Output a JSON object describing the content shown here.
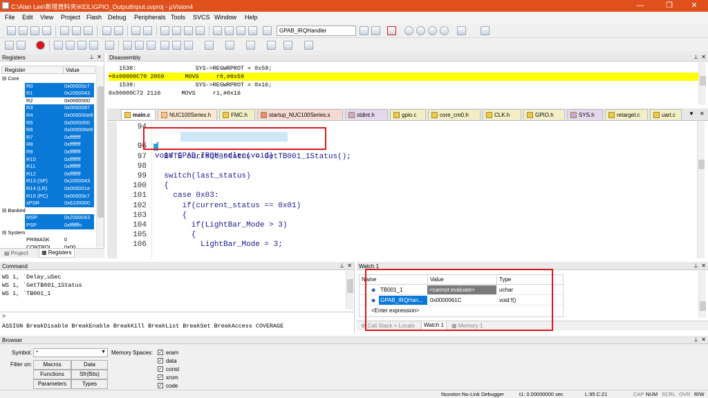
{
  "window": {
    "title": "C:\\Alan Lee\\新增資料夾\\KEIL\\GPIO_OutputInput.uvproj - µVision4",
    "min": "—",
    "max": "❐",
    "close": "✕"
  },
  "menu": [
    "File",
    "Edit",
    "View",
    "Project",
    "Flash",
    "Debug",
    "Peripherals",
    "Tools",
    "SVCS",
    "Window",
    "Help"
  ],
  "toolbar": {
    "function_combo": "GPAB_IRQHandler"
  },
  "registers": {
    "title": "Registers",
    "col_register": "Register",
    "col_value": "Value",
    "group_core": "Core",
    "core": [
      {
        "name": "R0",
        "value": "0x00000c7"
      },
      {
        "name": "R1",
        "value": "0x2000043"
      },
      {
        "name": "R2",
        "value": "0x0000000"
      },
      {
        "name": "R3",
        "value": "0x0000097"
      },
      {
        "name": "R4",
        "value": "0x000000e8"
      },
      {
        "name": "R5",
        "value": "0x0000000"
      },
      {
        "name": "R6",
        "value": "0x000000e8"
      },
      {
        "name": "R7",
        "value": "0xffffffff"
      },
      {
        "name": "R8",
        "value": "0xffffffff"
      },
      {
        "name": "R9",
        "value": "0xffffffff"
      },
      {
        "name": "R10",
        "value": "0xffffffff"
      },
      {
        "name": "R11",
        "value": "0xffffffff"
      },
      {
        "name": "R12",
        "value": "0xffffffff"
      },
      {
        "name": "R13 (SP)",
        "value": "0x2000043"
      },
      {
        "name": "R14 (LR)",
        "value": "0x000001e"
      },
      {
        "name": "R15 (PC)",
        "value": "0x00000c7"
      },
      {
        "name": "xPSR",
        "value": "0x6100000"
      }
    ],
    "group_banked": "Banked",
    "banked": [
      {
        "name": "MSP",
        "value": "0x2000043"
      },
      {
        "name": "PSP",
        "value": "0xfffffffc"
      }
    ],
    "group_system": "System",
    "system": [
      {
        "name": "PRIMASK",
        "value": "0"
      },
      {
        "name": "CONTROL",
        "value": "0x00"
      }
    ],
    "tab_project": "Project",
    "tab_registers": "Registers"
  },
  "disassembly": {
    "title": "Disassembly",
    "lines": [
      "   1538:                 SYS->REGWRPROT = 0x59;",
      "0x00000C70 2059      MOVS     r0,#0x59",
      "   1539:                 SYS->REGWRPROT = 0x16;",
      "0x00000C72 2116      MOVS     r1,#0x16"
    ]
  },
  "tabs": [
    "main.c",
    "NUC100Series.h",
    "FMC.h",
    "startup_NUC100Series.s",
    "stdint.h",
    "gpio.c",
    "core_cm0.h",
    "CLK.h",
    "GPIO.h",
    "SYS.h",
    "retarget.c",
    "uart.c"
  ],
  "code": {
    "lines": [
      {
        "n": "94",
        "t": ""
      },
      {
        "n": "95",
        "t": "void GPAB_IRQHandler(void)"
      },
      {
        "n": "96",
        "t": "{"
      },
      {
        "n": "97",
        "t": "  BYTE current_status = GetTB001_1Status();"
      },
      {
        "n": "98",
        "t": ""
      },
      {
        "n": "99",
        "t": "  switch(last_status)"
      },
      {
        "n": "100",
        "t": "  {"
      },
      {
        "n": "101",
        "t": "    case 0x03:"
      },
      {
        "n": "102",
        "t": "      if(current_status == 0x01)"
      },
      {
        "n": "103",
        "t": "      {"
      },
      {
        "n": "104",
        "t": "        if(LightBar_Mode > 3)"
      },
      {
        "n": "105",
        "t": "        {"
      },
      {
        "n": "106",
        "t": "          LightBar_Mode = 3;"
      }
    ]
  },
  "command": {
    "title": "Command",
    "lines": [
      "WS 1, `Delay_uSec",
      "WS 1, `GetTB001_1Status",
      "WS 1, `TB001_1"
    ],
    "prompt": ">",
    "hint": "ASSIGN BreakDisable BreakEnable BreakKill BreakList BreakSet BreakAccess COVERAGE"
  },
  "watch": {
    "title": "Watch 1",
    "col_name": "Name",
    "col_value": "Value",
    "col_type": "Type",
    "rows": [
      {
        "name": "TB001_1",
        "value": "<cannot evaluate>",
        "type": "uchar"
      },
      {
        "name": "GPAB_IRQHan...",
        "value": "0x0000061C",
        "type": "void f()"
      }
    ],
    "enter_expression": "<Enter expression>",
    "tab_callstack": "Call Stack + Locals",
    "tab_watch": "Watch 1",
    "tab_memory": "Memory 1"
  },
  "browser": {
    "title": "Browser",
    "symbol_label": "Symbol:",
    "symbol_value": "*",
    "filter_label": "Filter on:",
    "buttons": [
      "Macros",
      "Data",
      "Functions",
      "Sfr(Bits)",
      "Parameters",
      "Types"
    ],
    "memory_label": "Memory Spaces:",
    "memory_spaces": [
      "eram",
      "data",
      "const",
      "xrom",
      "code"
    ]
  },
  "statusbar": {
    "debugger": "Nuvoton Nu-Link Debugger",
    "time": "t1: 0.00000000 sec",
    "position": "L:95 C:21",
    "caps": "CAP",
    "num": "NUM",
    "scrl": "SCRL",
    "ovr": "OVR",
    "rw": "R/W"
  }
}
